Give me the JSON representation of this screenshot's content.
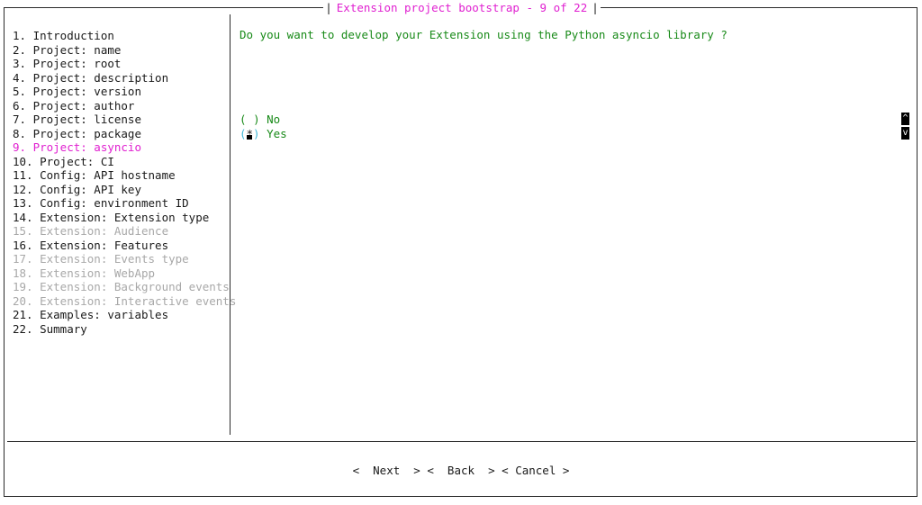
{
  "window": {
    "title": "Extension project bootstrap - 9 of 22",
    "title_left_bar": "|",
    "title_right_bar": "|"
  },
  "steps": [
    {
      "label": "1. Introduction",
      "state": "normal"
    },
    {
      "label": "2. Project: name",
      "state": "normal"
    },
    {
      "label": "3. Project: root",
      "state": "normal"
    },
    {
      "label": "4. Project: description",
      "state": "normal"
    },
    {
      "label": "5. Project: version",
      "state": "normal"
    },
    {
      "label": "6. Project: author",
      "state": "normal"
    },
    {
      "label": "7. Project: license",
      "state": "normal"
    },
    {
      "label": "8. Project: package",
      "state": "normal"
    },
    {
      "label": "9. Project: asyncio",
      "state": "active"
    },
    {
      "label": "10. Project: CI",
      "state": "normal"
    },
    {
      "label": "11. Config: API hostname",
      "state": "normal"
    },
    {
      "label": "12. Config: API key",
      "state": "normal"
    },
    {
      "label": "13. Config: environment ID",
      "state": "normal"
    },
    {
      "label": "14. Extension: Extension type",
      "state": "normal"
    },
    {
      "label": "15. Extension: Audience",
      "state": "disabled"
    },
    {
      "label": "16. Extension: Features",
      "state": "normal"
    },
    {
      "label": "17. Extension: Events type",
      "state": "disabled"
    },
    {
      "label": "18. Extension: WebApp",
      "state": "disabled"
    },
    {
      "label": "19. Extension: Background events",
      "state": "disabled"
    },
    {
      "label": "20. Extension: Interactive events",
      "state": "disabled"
    },
    {
      "label": "21. Examples: variables",
      "state": "normal"
    },
    {
      "label": "22. Summary",
      "state": "normal"
    }
  ],
  "question": "Do you want to develop your Extension using the Python asyncio library ?",
  "options": [
    {
      "open": "(",
      "mark": " ",
      "close": ")",
      "label": "No",
      "selected": false
    },
    {
      "open": "(",
      "mark": "*",
      "close": ")",
      "label": "Yes",
      "selected": true
    }
  ],
  "scrollbar": {
    "up_glyph": "^",
    "down_glyph": "v"
  },
  "buttons": {
    "next": "<  Next  >",
    "back": "<  Back  >",
    "cancel": "< Cancel >"
  },
  "colors": {
    "accent": "#e020d0",
    "question": "#188a18",
    "disabled": "#a8a8a8",
    "focus": "#3fb8d8"
  }
}
